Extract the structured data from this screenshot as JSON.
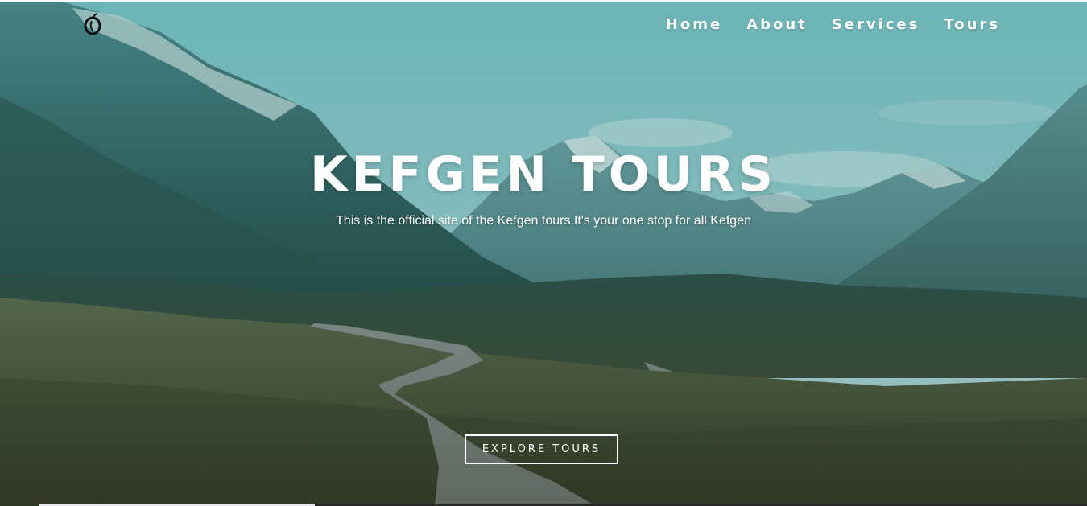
{
  "brand": {
    "logo_icon": "apple-logo-icon"
  },
  "nav": {
    "items": [
      {
        "label": "Home"
      },
      {
        "label": "About"
      },
      {
        "label": "Services"
      },
      {
        "label": "Tours"
      }
    ]
  },
  "hero": {
    "title": "KEFGEN TOURS",
    "subtitle": "This is the official site of the Kefgen tours.It's your one stop for all Kefgen",
    "cta_label": "EXPLORE TOURS"
  },
  "colors": {
    "text": "#ffffff",
    "overlay_tint": "#388c8c"
  }
}
